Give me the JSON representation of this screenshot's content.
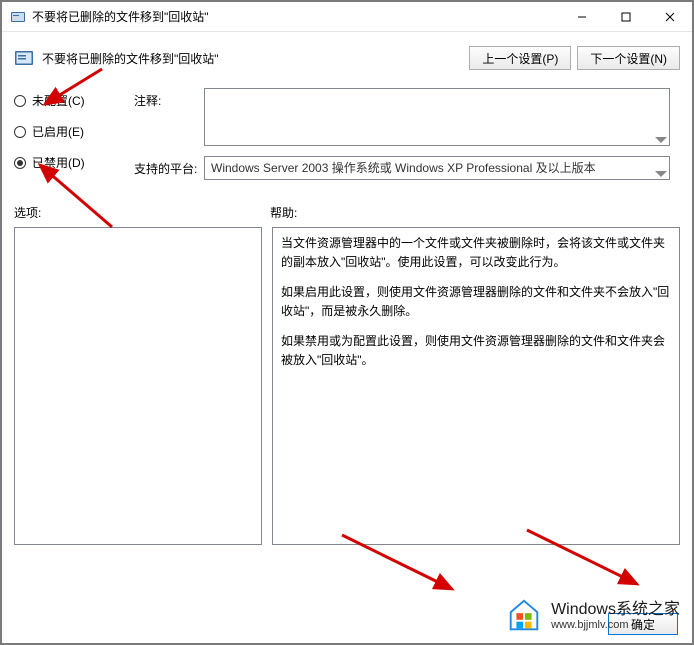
{
  "window": {
    "title": "不要将已删除的文件移到\"回收站\"",
    "minimize": "—",
    "maximize": "☐",
    "close": "✕"
  },
  "header": {
    "title": "不要将已删除的文件移到\"回收站\"",
    "prev": "上一个设置(P)",
    "next": "下一个设置(N)"
  },
  "radios": {
    "not_configured": "未配置(C)",
    "enabled": "已启用(E)",
    "disabled": "已禁用(D)",
    "selected": "disabled"
  },
  "fields": {
    "comment_label": "注释:",
    "comment_value": "",
    "platform_label": "支持的平台:",
    "platform_value": "Windows Server 2003 操作系统或 Windows XP Professional 及以上版本"
  },
  "panels": {
    "options_label": "选项:",
    "help_label": "帮助:",
    "help_paragraphs": [
      "当文件资源管理器中的一个文件或文件夹被删除时，会将该文件或文件夹的副本放入\"回收站\"。使用此设置，可以改变此行为。",
      "如果启用此设置，则使用文件资源管理器删除的文件和文件夹不会放入\"回收站\"，而是被永久删除。",
      "如果禁用或为配置此设置，则使用文件资源管理器删除的文件和文件夹会被放入\"回收站\"。"
    ]
  },
  "footer": {
    "ok": "确定"
  },
  "watermark": {
    "line1": "Windows系统之家",
    "line2": "www.bjjmlv.com"
  }
}
